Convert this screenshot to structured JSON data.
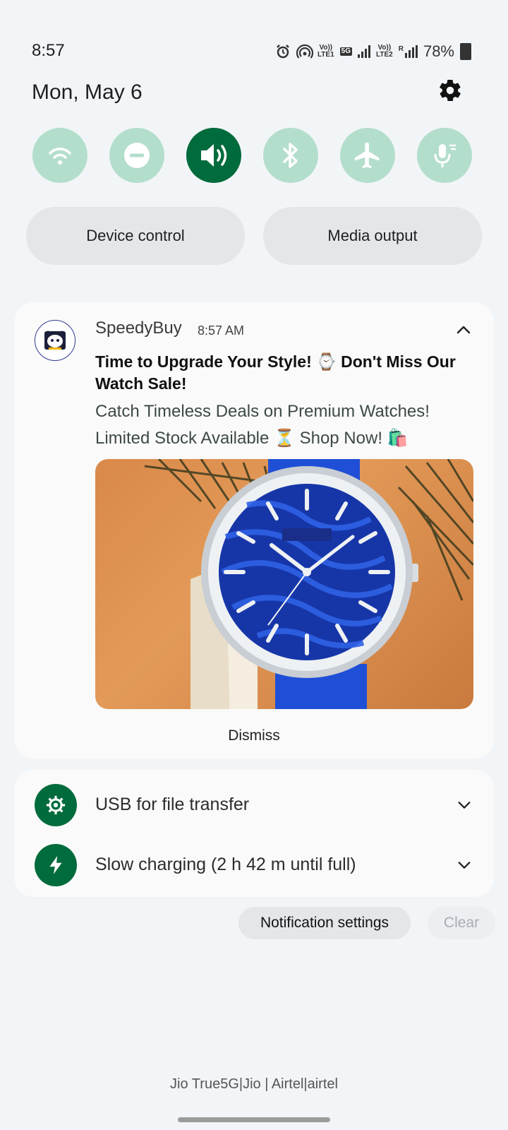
{
  "status_bar": {
    "time": "8:57",
    "battery": "78%",
    "net1": "LTE1",
    "net2": "LTE2",
    "fiveg": "5G",
    "roaming": "R",
    "icons": [
      "alarm-icon",
      "hotspot-icon",
      "volte-lte1-icon",
      "5g-icon",
      "signal-icon",
      "volte-lte2-icon",
      "signal-roaming-icon",
      "battery-charging-icon"
    ]
  },
  "header": {
    "date": "Mon, May 6",
    "settings_icon": "gear-icon"
  },
  "quick_tiles": [
    {
      "name": "wifi",
      "icon": "wifi-icon",
      "active": false
    },
    {
      "name": "do-not-disturb",
      "icon": "dnd-icon",
      "active": false
    },
    {
      "name": "sound",
      "icon": "volume-icon",
      "active": true
    },
    {
      "name": "bluetooth",
      "icon": "bluetooth-icon",
      "active": false
    },
    {
      "name": "airplane-mode",
      "icon": "airplane-icon",
      "active": false
    },
    {
      "name": "mic-access",
      "icon": "microphone-icon",
      "active": false
    }
  ],
  "buttons": {
    "device_control": "Device control",
    "media_output": "Media output"
  },
  "notification": {
    "app_name": "SpeedyBuy",
    "time": "8:57 AM",
    "title": "Time to Upgrade Your Style! ⌚ Don't Miss Our Watch Sale!",
    "body": "Catch Timeless Deals on Premium Watches! Limited Stock Available ⏳ Shop Now! 🛍️",
    "dismiss": "Dismiss"
  },
  "silent": [
    {
      "label": "USB for file transfer",
      "icon": "usb-settings-icon"
    },
    {
      "label": "Slow charging (2 h 42 m until full)",
      "icon": "charging-bolt-icon"
    }
  ],
  "footer": {
    "notification_settings": "Notification settings",
    "clear": "Clear",
    "carrier": "Jio True5G|Jio | Airtel|airtel"
  },
  "colors": {
    "accent": "#006b3c",
    "tile_inactive": "#b4decc",
    "background": "#f2f5f8"
  }
}
